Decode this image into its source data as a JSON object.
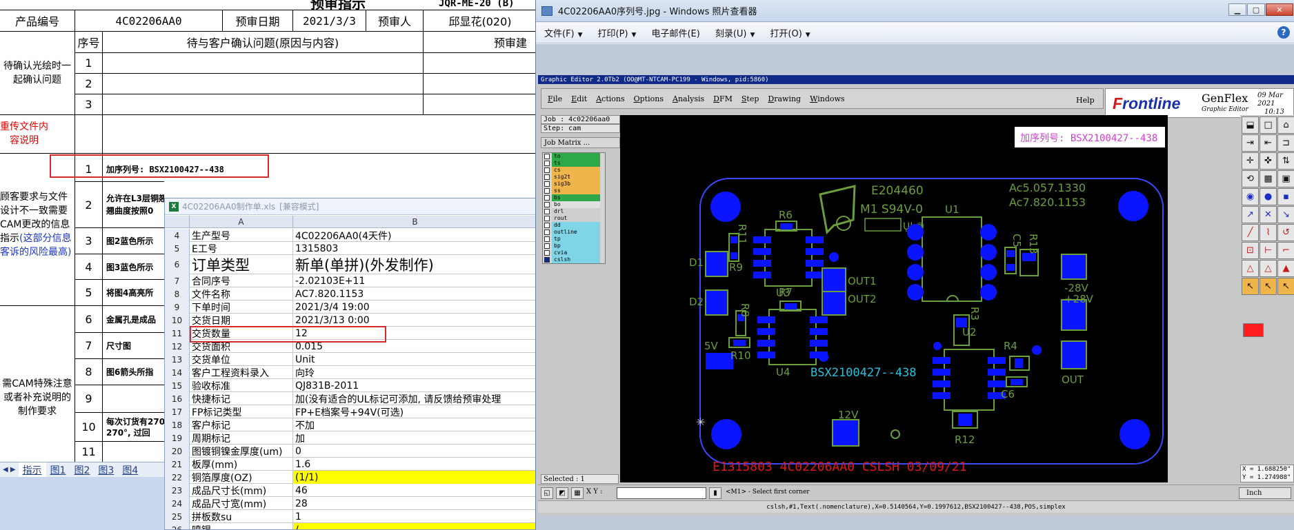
{
  "sheet": {
    "title": "预审指示",
    "form_code": "JQR-ME-20 (B)",
    "header_row": {
      "product_label": "产品编号",
      "product_value": "4C02206AA0",
      "date_label": "预审日期",
      "date_value": "2021/3/3",
      "reviewer_label": "预审人",
      "reviewer_value": "邱显花(020)"
    },
    "columns": {
      "seq": "序号",
      "question": "待与客户确认问题(原因与内容)",
      "advice": "预审建"
    },
    "sections": {
      "confirm": "待确认光绘时一起确认问题",
      "upload": "重传文件内容说明",
      "mismatch_a": "顾客要求与文件设计不一致需要CAM更改的信息指示",
      "mismatch_b": "(这部分信息客诉的风险最高)",
      "special": "需CAM特殊注意或者补充说明的制作要求"
    },
    "rows": [
      {
        "n": "1",
        "text": ""
      },
      {
        "n": "2",
        "text": ""
      },
      {
        "n": "3",
        "text": ""
      },
      {
        "n": "1",
        "text": "加序列号: BSX2100427--438"
      },
      {
        "n": "2",
        "text": "允许在L3层铜翘曲度按照0"
      },
      {
        "n": "3",
        "text": "图2蓝色所示"
      },
      {
        "n": "4",
        "text": "图3蓝色所示"
      },
      {
        "n": "5",
        "text": "将图4高亮所"
      },
      {
        "n": "6",
        "text": "金属孔是成品"
      },
      {
        "n": "7",
        "text": "尺寸图"
      },
      {
        "n": "8",
        "text": "图6箭头所指"
      },
      {
        "n": "9",
        "text": ""
      },
      {
        "n": "10",
        "text": "每次订货有270°, 过回"
      },
      {
        "n": "11",
        "text": ""
      }
    ],
    "row2_line2": "翘曲度按照0",
    "row10_line2": "270°, 过回",
    "tabs": [
      "指示",
      "图1",
      "图2",
      "图3",
      "图4"
    ]
  },
  "excel": {
    "title": "4C02206AA0制作单.xls",
    "mode": "[兼容模式]",
    "col_a": "A",
    "col_b": "B",
    "rows": [
      {
        "n": "4",
        "k": "生产型号",
        "v": "4C02206AA0(4天件)"
      },
      {
        "n": "5",
        "k": "E工号",
        "v": "1315803"
      },
      {
        "n": "6",
        "k": "订单类型",
        "v": "新单(单拼)(外发制作)"
      },
      {
        "n": "7",
        "k": "合同序号",
        "v": "-2.02103E+11"
      },
      {
        "n": "8",
        "k": "文件名称",
        "v": "AC7.820.1153"
      },
      {
        "n": "9",
        "k": "下单时间",
        "v": "2021/3/4 19:00"
      },
      {
        "n": "10",
        "k": "交货日期",
        "v": "2021/3/13 0:00"
      },
      {
        "n": "11",
        "k": "交货数量",
        "v": "12"
      },
      {
        "n": "12",
        "k": "交货面积",
        "v": "0.015"
      },
      {
        "n": "13",
        "k": "交货单位",
        "v": "Unit"
      },
      {
        "n": "14",
        "k": "客户工程资料录入",
        "v": "向玲"
      },
      {
        "n": "15",
        "k": "验收标准",
        "v": "QJ831B-2011"
      },
      {
        "n": "16",
        "k": "快捷标记",
        "v": "加(没有适合的UL标记可添加, 请反馈给预审处理"
      },
      {
        "n": "17",
        "k": "FP标记类型",
        "v": "FP+E档案号+94V(可选)"
      },
      {
        "n": "18",
        "k": "客户标记",
        "v": "不加"
      },
      {
        "n": "19",
        "k": "周期标记",
        "v": "加"
      },
      {
        "n": "20",
        "k": "图镀铜镍金厚度(um)",
        "v": "0"
      },
      {
        "n": "21",
        "k": "板厚(mm)",
        "v": "1.6"
      },
      {
        "n": "22",
        "k": "铜箔厚度(OZ)",
        "v": " (1/1)"
      },
      {
        "n": "23",
        "k": "成品尺寸长(mm)",
        "v": "46"
      },
      {
        "n": "24",
        "k": "成品尺寸宽(mm)",
        "v": "28"
      },
      {
        "n": "25",
        "k": "拼板数su",
        "v": "1"
      },
      {
        "n": "26",
        "k": "喷锡",
        "v": "/"
      }
    ]
  },
  "viewer": {
    "title": "4C02206AA0序列号.jpg - Windows 照片查看器",
    "menu": [
      "文件(F)",
      "打印(P)",
      "电子邮件(E)",
      "刻录(U)",
      "打开(O)"
    ]
  },
  "cam": {
    "title": "Graphic Editor 2.0Tb2 (OO@MT-NTCAM-PC199 - Windows, pid:5860)",
    "menu": [
      "File",
      "Edit",
      "Actions",
      "Options",
      "Analysis",
      "DFM",
      "Step",
      "Drawing",
      "Windows"
    ],
    "help": "Help",
    "brand": "Frontline",
    "brand_f": "F",
    "brand_rest": "rontline",
    "genflex": "GenFlex",
    "graphic_editor": "Graphic Editor",
    "date": "09 Mar 2021",
    "time": "10:13 AM",
    "job": "Job : 4c02206aa0",
    "step": "Step: cam",
    "job_matrix": "Job Matrix ...",
    "layers": [
      "to",
      "ts",
      "cs",
      "sig2t",
      "sig3b",
      "ss",
      "bs",
      "bo",
      "drl",
      "rout",
      "dd",
      "outline",
      "tp",
      "bp",
      "cvia",
      "cslsh"
    ],
    "selected": "Selected : 1",
    "xy_label": "X Y :",
    "prompt": "<M1> - Select first corner",
    "unit": "Inch",
    "coord_x": "X = 1.688250\"",
    "coord_y": "Y = 1.274988\"",
    "status": "cslsh,#1,Text(.nomenclature),X=0.5140564,Y=0.1997612,BSX2100427--438,POS,simplex",
    "annotation": "加序列号: BSX2100427--438",
    "board_text": {
      "e_number": "E204460",
      "material": "M1 S94V-0",
      "ac1": "Ac5.057.1330",
      "ac2": "Ac7.820.1153",
      "serial": "BSX2100427--438",
      "bottom": "E1315803 4C02206AA0 CSLSH 03/09/21",
      "labels": [
        "R6",
        "R11",
        "R9",
        "U3",
        "D1",
        "D2",
        "R8",
        "R7",
        "R10",
        "U4",
        "U1",
        "C5",
        "R13",
        "R3",
        "U2",
        "R4",
        "C6",
        "R12",
        "OUT1",
        "OUT2",
        "5V",
        "12V",
        "-28V",
        "+28V",
        "OUT"
      ]
    }
  },
  "colors": {
    "board_outline": "#3a48ff",
    "pads": "#0a14ff",
    "silk": "#6b9e3c",
    "serial": "#22c3e0",
    "bottom_text": "#e01818",
    "annotation": "#d040d0",
    "highlight_box": "#d62a2a"
  }
}
